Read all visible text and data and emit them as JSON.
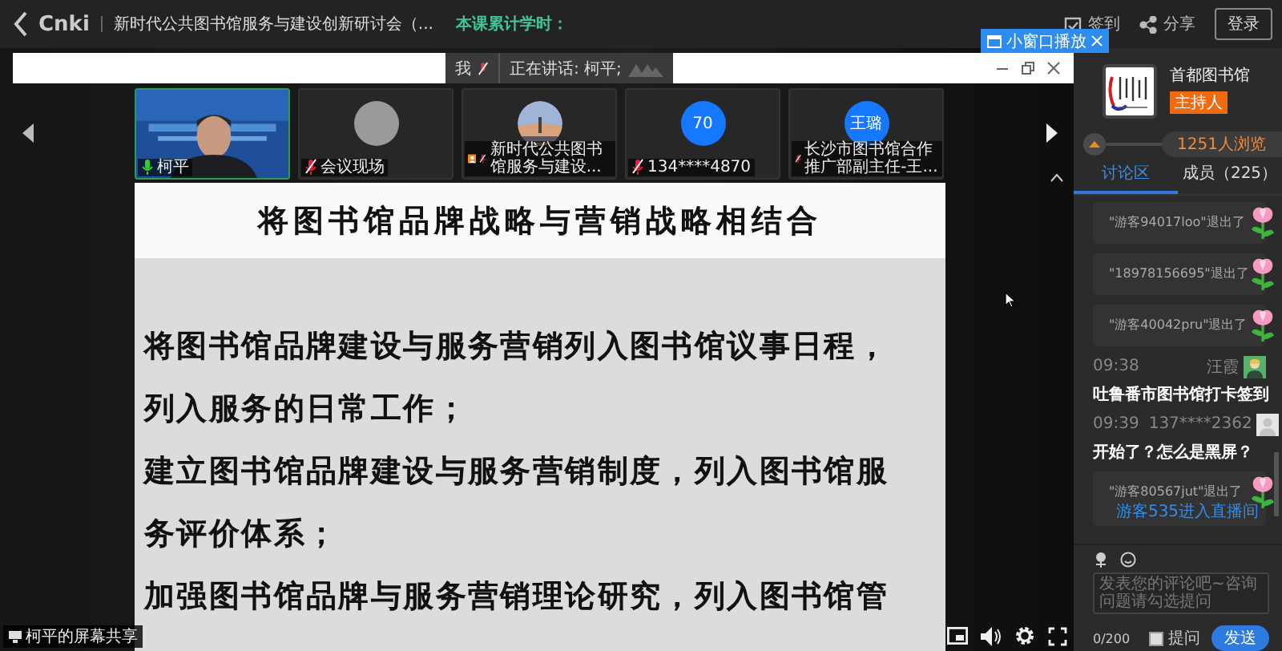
{
  "header": {
    "logo": "Cnki",
    "title": "新时代公共图书馆服务与建设创新研讨会（...",
    "study_hours_label": "本课累计学时：",
    "actions": [
      {
        "label": "签到",
        "kind": "checkin"
      },
      {
        "label": "分享",
        "kind": "share"
      }
    ],
    "login_button": "登录"
  },
  "mini_window_button": "小窗口播放",
  "speaking": {
    "self": "我",
    "label": "正在讲话: 柯平;"
  },
  "participants": [
    {
      "name": "柯平",
      "kind": "video",
      "muted": false,
      "host": false,
      "selected": true
    },
    {
      "name": "会议现场",
      "kind": "avatar-grey",
      "muted": true,
      "host": false,
      "selected": false
    },
    {
      "name": "新时代公共图书馆服务与建设...",
      "kind": "avatar-photo",
      "muted": true,
      "host": true,
      "selected": false
    },
    {
      "name": "134****4870",
      "kind": "initials",
      "initials": "70",
      "muted": true,
      "host": false,
      "selected": false
    },
    {
      "name": "长沙市图书馆合作推广部副主任-王...",
      "kind": "initials",
      "initials": "王璐",
      "muted": true,
      "host": false,
      "selected": false
    }
  ],
  "slide": {
    "title": "将图书馆品牌战略与营销战略相结合",
    "lines": [
      "将图书馆品牌建设与服务营销列入图书馆议事日程，",
      "列入服务的日常工作；",
      "建立图书馆品牌建设与服务营销制度，列入图书馆服",
      "务评价体系；",
      "加强图书馆品牌与服务营销理论研究，列入图书馆管"
    ]
  },
  "screen_share_label": "柯平的屏幕共享",
  "host": {
    "name": "首都图书馆",
    "role": "主持人"
  },
  "viewers": "1251人浏览",
  "tabs": [
    {
      "label": "讨论区",
      "selected": true
    },
    {
      "label": "成员（225）",
      "selected": false
    }
  ],
  "chat": [
    {
      "kind": "exit",
      "text": "\"游客94017loo\"退出了"
    },
    {
      "kind": "exit",
      "text": "\"18978156695\"退出了"
    },
    {
      "kind": "exit",
      "text": "\"游客40042pru\"退出了"
    },
    {
      "kind": "message",
      "time": "09:38",
      "user": "汪霞",
      "avatar": {
        "kind": "person"
      },
      "text": "吐鲁番市图书馆打卡签到"
    },
    {
      "kind": "message",
      "time": "09:39",
      "user": "137****2362",
      "avatar": {
        "kind": "blank"
      },
      "text": "开始了？怎么是黑屏？"
    },
    {
      "kind": "exit",
      "text": "\"游客80567jut\"退出了",
      "notice": "游客535进入直播间"
    }
  ],
  "composer": {
    "placeholder": "发表您的评论吧~咨询问题请勾选提问",
    "counter": "0/200",
    "question_checkbox": {
      "label": "提问",
      "checked": false
    },
    "send_button": "发送"
  }
}
